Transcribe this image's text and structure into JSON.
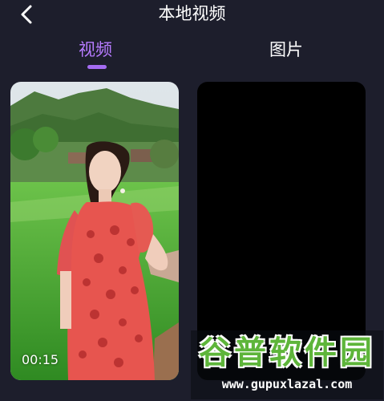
{
  "header": {
    "title": "本地视频",
    "back_icon": "chevron-left-icon"
  },
  "tabs": [
    {
      "label": "视频",
      "active": true
    },
    {
      "label": "图片",
      "active": false
    }
  ],
  "videos": [
    {
      "duration": "00:15",
      "thumbnail": "woman in red floral dress standing by green rice field with mountains"
    },
    {
      "duration": "",
      "thumbnail": "black"
    }
  ],
  "watermark": {
    "title": "谷普软件园",
    "url": "www.gupuxlazal.com"
  },
  "colors": {
    "background": "#1d1e2c",
    "active_tab": "#b67bff",
    "indicator": "#a46cf2",
    "watermark_green": "#5eb53a"
  }
}
